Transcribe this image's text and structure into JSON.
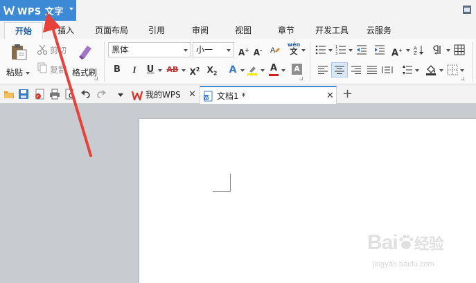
{
  "app": {
    "title": "WPS 文字",
    "accent": "#3c8ad6"
  },
  "tabs": [
    {
      "label": "开始",
      "active": true
    },
    {
      "label": "插入"
    },
    {
      "label": "页面布局"
    },
    {
      "label": "引用"
    },
    {
      "label": "审阅"
    },
    {
      "label": "视图"
    },
    {
      "label": "章节"
    },
    {
      "label": "开发工具"
    },
    {
      "label": "云服务"
    }
  ],
  "ribbon": {
    "paste_label": "粘贴",
    "cut_label": "剪切",
    "copy_label": "复制",
    "format_painter_label": "格式刷",
    "font_name": "黑体",
    "font_size": "小一",
    "bold": "B",
    "italic": "I",
    "underline": "U",
    "strikethrough": "AB",
    "superscript": "X",
    "superscript_mark": "2",
    "subscript": "X",
    "subscript_mark": "2",
    "grow_font": "A",
    "shrink_font": "A",
    "text_effect": "A",
    "font_color": "A",
    "char_shading": "A",
    "phonetic": "wén",
    "case_change": "A"
  },
  "doc_tabs": [
    {
      "label": "我的WPS"
    },
    {
      "label": "文档1 *",
      "active": true
    }
  ],
  "watermark": {
    "brand": "Bai",
    "brand_tail": "经验",
    "url": "jingyan.baidu.com"
  },
  "annotation": {
    "arrow_color": "#e8413a"
  }
}
